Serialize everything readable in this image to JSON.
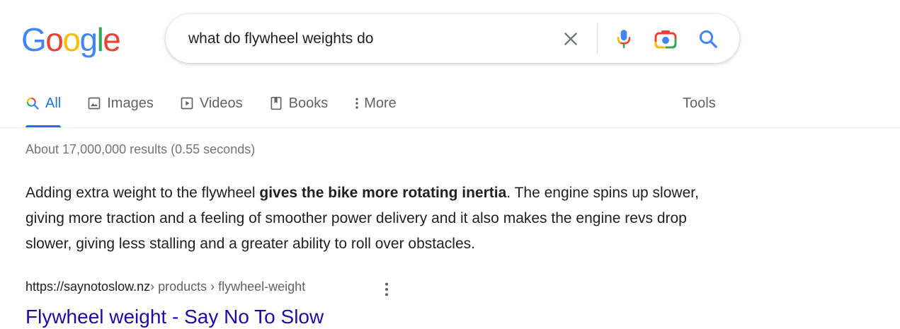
{
  "logo": {
    "letters": [
      {
        "char": "G",
        "color": "#4285F4"
      },
      {
        "char": "o",
        "color": "#EA4335"
      },
      {
        "char": "o",
        "color": "#FBBC05"
      },
      {
        "char": "g",
        "color": "#4285F4"
      },
      {
        "char": "l",
        "color": "#34A853"
      },
      {
        "char": "e",
        "color": "#EA4335"
      }
    ]
  },
  "search": {
    "value": "what do flywheel weights do",
    "icons": [
      "clear-icon",
      "microphone-icon",
      "camera-lens-icon",
      "search-icon"
    ]
  },
  "tabs": [
    {
      "label": "All",
      "icon": "search-icon",
      "active": true
    },
    {
      "label": "Images",
      "icon": "image-icon",
      "active": false
    },
    {
      "label": "Videos",
      "icon": "play-icon",
      "active": false
    },
    {
      "label": "Books",
      "icon": "book-icon",
      "active": false
    },
    {
      "label": "More",
      "icon": "more-vert-icon",
      "active": false
    }
  ],
  "tools_label": "Tools",
  "result_stats": "About 17,000,000 results (0.55 seconds)",
  "snippet": {
    "before": "Adding extra weight to the flywheel ",
    "bold": "gives the bike more rotating inertia",
    "after": ". The engine spins up slower, giving more traction and a feeling of smoother power delivery and it also makes the engine revs drop slower, giving less stalling and a greater ability to roll over obstacles."
  },
  "result": {
    "cite_domain": "https://saynotoslow.nz",
    "cite_path": " › products › flywheel-weight",
    "title": "Flywheel weight - Say No To Slow"
  },
  "colors": {
    "link": "#1a0dab",
    "accent": "#1a73e8",
    "muted": "#5f6368"
  }
}
